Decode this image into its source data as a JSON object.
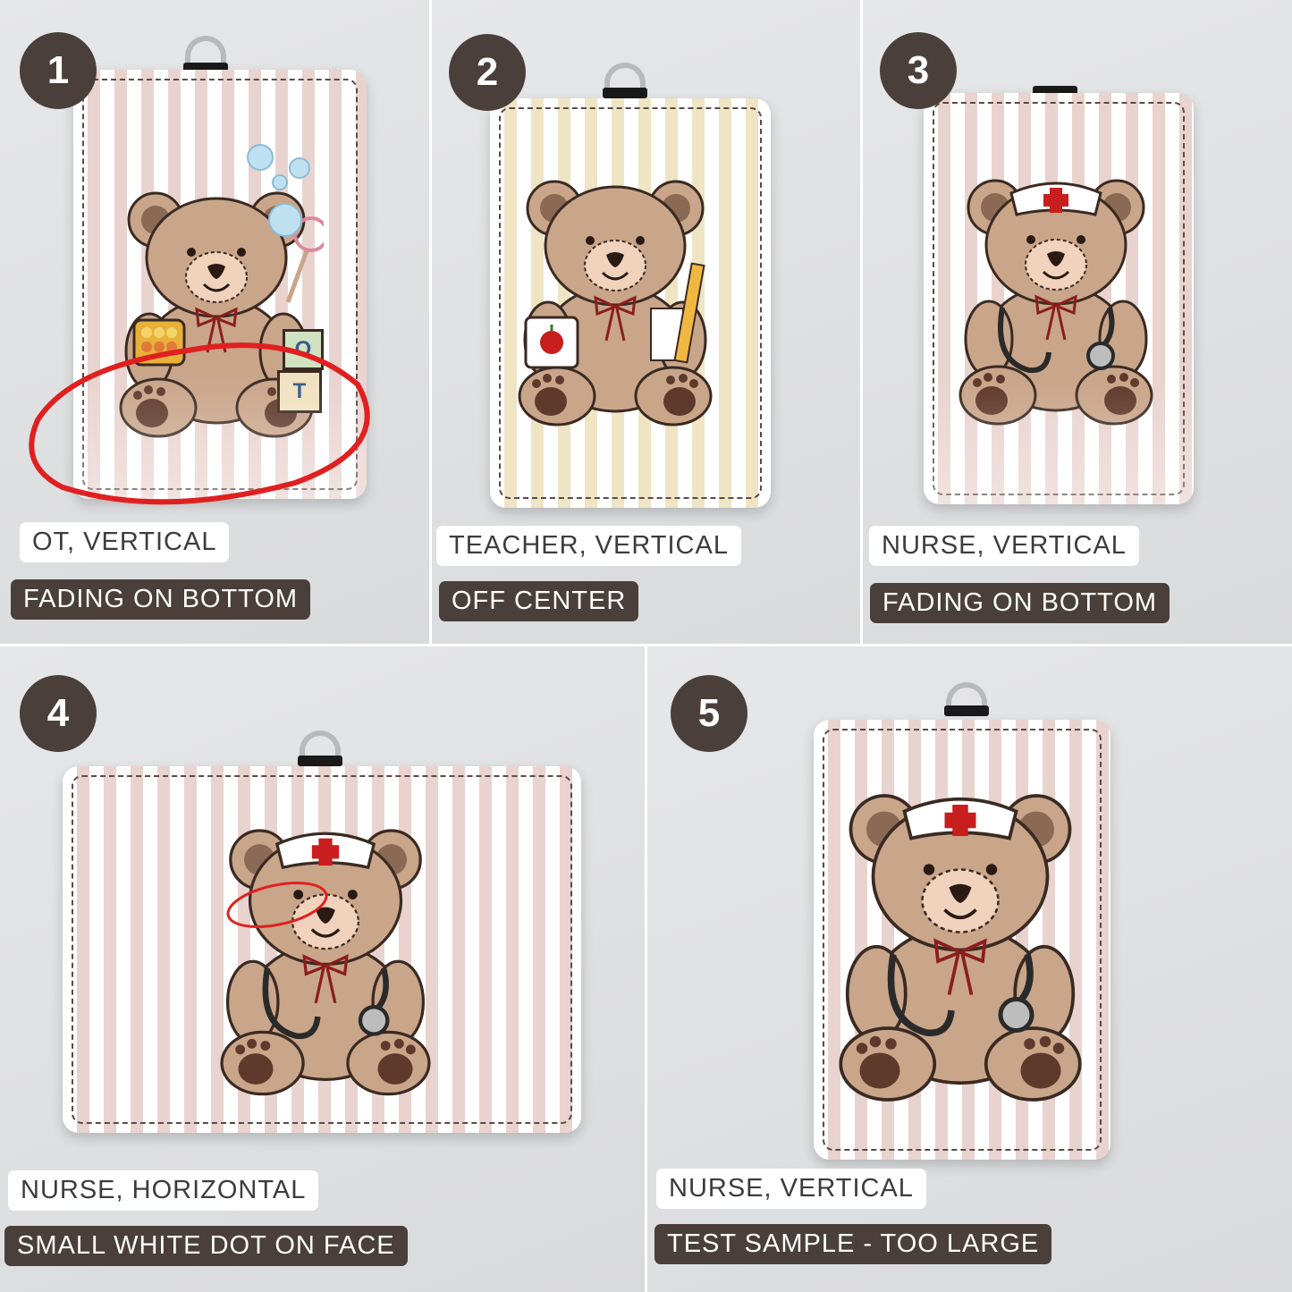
{
  "panels": [
    {
      "number": "1",
      "title": "OT, VERTICAL",
      "issue": "FADING ON BOTTOM"
    },
    {
      "number": "2",
      "title": "TEACHER, VERTICAL",
      "issue": "OFF CENTER"
    },
    {
      "number": "3",
      "title": "NURSE, VERTICAL",
      "issue": "FADING ON BOTTOM"
    },
    {
      "number": "4",
      "title": "NURSE, HORIZONTAL",
      "issue": "SMALL WHITE DOT ON FACE"
    },
    {
      "number": "5",
      "title": "NURSE, VERTICAL",
      "issue": "TEST SAMPLE - TOO LARGE"
    }
  ],
  "ot_blocks": {
    "top": "O",
    "front": "T"
  },
  "colors": {
    "badge": "#4a3f3a",
    "bear_fur": "#c9a58a",
    "bear_dark": "#8a6a55",
    "annotation_red": "#e02020",
    "pink_stripe": "#e9d3cf",
    "yellow_stripe": "#efe4c4"
  }
}
